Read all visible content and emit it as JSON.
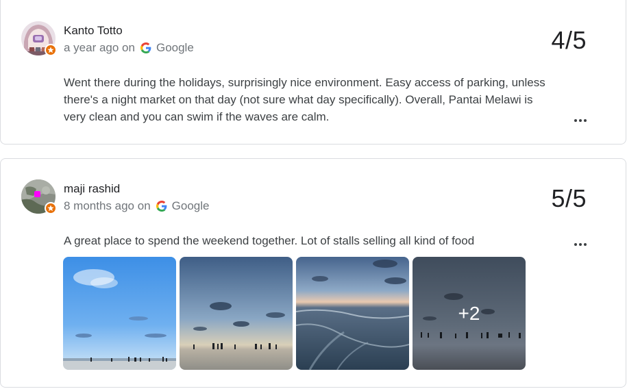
{
  "reviews": [
    {
      "name": "Kanto Totto",
      "time": "a year ago on",
      "source": "Google",
      "rating": "4/5",
      "text": "Went there during the holidays, surprisingly nice environment. Easy access of parking, unless there's a night market on that day (not sure what day specifically). Overall, Pantai Melawi is very clean and you can swim if the waves are calm.",
      "avatar_icon": "anime-character-avatar",
      "badge_icon": "local-guide-star-icon"
    },
    {
      "name": "maji rashid",
      "time": "8 months ago on",
      "source": "Google",
      "rating": "5/5",
      "text": "A great place to spend the weekend together. Lot of stalls selling all kind of food",
      "avatar_icon": "user-photo-avatar",
      "badge_icon": "local-guide-star-icon",
      "photos": [
        {
          "subject": "blue sky over beach"
        },
        {
          "subject": "beach at dusk with people"
        },
        {
          "subject": "waves on shore at sunset"
        },
        {
          "subject": "crowd on beach"
        }
      ],
      "more_photos_label": "+2"
    }
  ],
  "colors": {
    "text_primary": "#202124",
    "text_secondary": "#70757a",
    "badge_orange": "#e8710a",
    "card_border": "#dadce0"
  }
}
